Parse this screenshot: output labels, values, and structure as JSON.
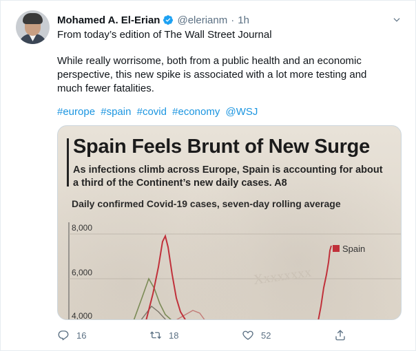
{
  "author": {
    "name": "Mohamed A. El-Erian",
    "handle": "@elerianm",
    "separator": "·",
    "time": "1h"
  },
  "tweet": {
    "line1": "From today’s edition of The Wall Street Journal",
    "paragraph": "While really worrisome, both from a public health and an economic perspective, this new spike is associated with a lot more testing and much fewer fatalities.",
    "hashtags": [
      "#europe",
      "#spain",
      "#covid",
      "#economy",
      "@WSJ"
    ]
  },
  "media": {
    "headline": "Spain Feels Brunt of New Surge",
    "subhead": "As infections climb across Europe, Spain is accounting for about a third of the Continent’s new daily cases. A8",
    "chart_caption": "Daily confirmed Covid-19 cases, seven-day rolling average",
    "legend_label": "Spain",
    "y_ticks": [
      "8,000",
      "6,000",
      "4,000"
    ]
  },
  "actions": {
    "reply_count": "16",
    "retweet_count": "18",
    "like_count": "52"
  },
  "colors": {
    "link": "#1b95e0",
    "muted": "#5b7083",
    "spain_series": "#c0303a",
    "verified": "#1da1f2"
  },
  "icons": [
    "verified-badge-icon",
    "chevron-down-icon",
    "reply-icon",
    "retweet-icon",
    "like-icon",
    "share-icon"
  ]
}
